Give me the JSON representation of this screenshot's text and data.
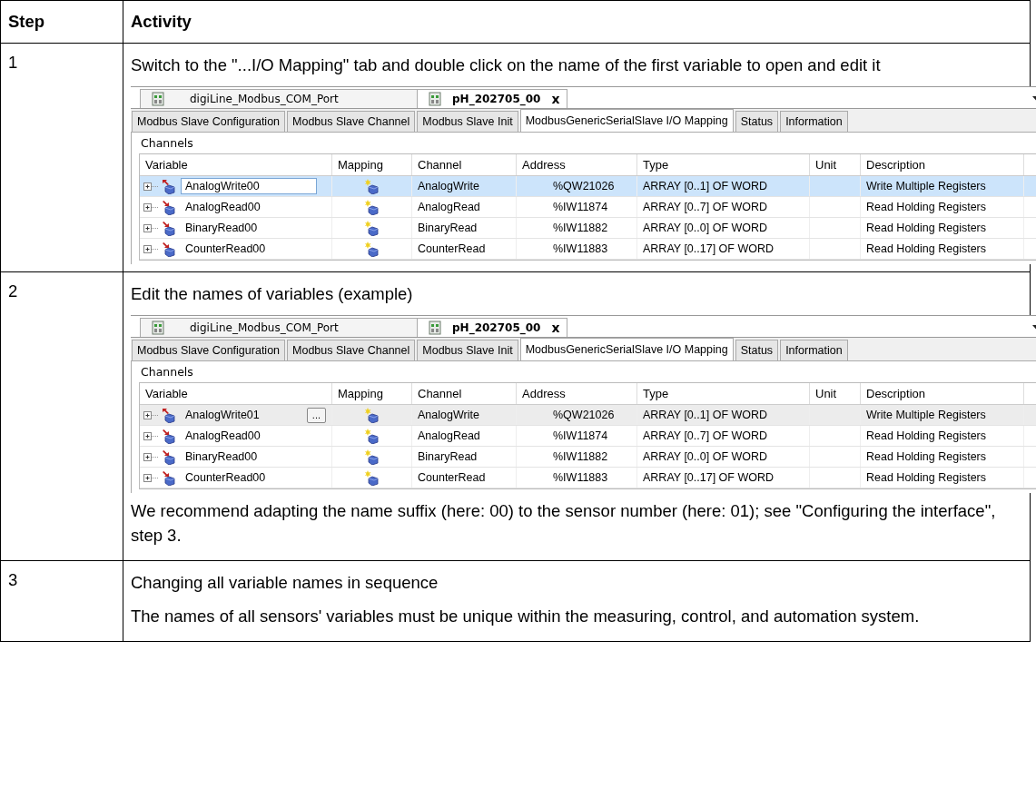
{
  "table": {
    "columns": [
      "Step",
      "Activity"
    ],
    "rows": [
      {
        "step": "1",
        "blocks": [
          {
            "kind": "text",
            "text": "Switch to the \"...I/O Mapping\" tab and double click on the name of the first variable to open and edit it"
          },
          {
            "kind": "screenshot",
            "screen": {
              "doc_tabs": [
                {
                  "label": "digiLine_Modbus_COM_Port",
                  "selected": false
                },
                {
                  "label": "pH_202705_00",
                  "selected": true,
                  "close": "x"
                }
              ],
              "view_tabs": [
                {
                  "label": "Modbus Slave Configuration",
                  "selected": false
                },
                {
                  "label": "Modbus Slave Channel",
                  "selected": false
                },
                {
                  "label": "Modbus Slave Init",
                  "selected": false
                },
                {
                  "label": "ModbusGenericSerialSlave I/O Mapping",
                  "selected": true
                },
                {
                  "label": "Status",
                  "selected": false
                },
                {
                  "label": "Information",
                  "selected": false
                }
              ],
              "group": "Channels",
              "columns": [
                "Variable",
                "Mapping",
                "Channel",
                "Address",
                "Type",
                "Unit",
                "Description"
              ],
              "rows": [
                {
                  "variable": "AnalogWrite00",
                  "channel": "AnalogWrite",
                  "address": "%QW21026",
                  "type": "ARRAY [0..1] OF WORD",
                  "description": "Write Multiple Registers",
                  "selected": true,
                  "editing": true,
                  "output": true
                },
                {
                  "variable": "AnalogRead00",
                  "channel": "AnalogRead",
                  "address": "%IW11874",
                  "type": "ARRAY [0..7] OF WORD",
                  "description": "Read Holding Registers",
                  "selected": false,
                  "editing": false,
                  "output": false
                },
                {
                  "variable": "BinaryRead00",
                  "channel": "BinaryRead",
                  "address": "%IW11882",
                  "type": "ARRAY [0..0] OF WORD",
                  "description": "Read Holding Registers",
                  "selected": false,
                  "editing": false,
                  "output": false
                },
                {
                  "variable": "CounterRead00",
                  "channel": "CounterRead",
                  "address": "%IW11883",
                  "type": "ARRAY [0..17] OF WORD",
                  "description": "Read Holding Registers",
                  "selected": false,
                  "editing": false,
                  "output": false
                }
              ]
            }
          }
        ]
      },
      {
        "step": "2",
        "blocks": [
          {
            "kind": "text",
            "text": "Edit the names of variables (example)"
          },
          {
            "kind": "screenshot",
            "screen": {
              "doc_tabs": [
                {
                  "label": "digiLine_Modbus_COM_Port",
                  "selected": false
                },
                {
                  "label": "pH_202705_00",
                  "selected": true,
                  "close": "x"
                }
              ],
              "view_tabs": [
                {
                  "label": "Modbus Slave Configuration",
                  "selected": false
                },
                {
                  "label": "Modbus Slave Channel",
                  "selected": false
                },
                {
                  "label": "Modbus Slave Init",
                  "selected": false
                },
                {
                  "label": "ModbusGenericSerialSlave I/O Mapping",
                  "selected": true
                },
                {
                  "label": "Status",
                  "selected": false
                },
                {
                  "label": "Information",
                  "selected": false
                }
              ],
              "group": "Channels",
              "columns": [
                "Variable",
                "Mapping",
                "Channel",
                "Address",
                "Type",
                "Unit",
                "Description"
              ],
              "rows": [
                {
                  "variable": "AnalogWrite01",
                  "edit_button": "...",
                  "channel": "AnalogWrite",
                  "address": "%QW21026",
                  "type": "ARRAY [0..1] OF WORD",
                  "description": "Write Multiple Registers",
                  "selected": false,
                  "editing": true,
                  "output": true
                },
                {
                  "variable": "AnalogRead00",
                  "channel": "AnalogRead",
                  "address": "%IW11874",
                  "type": "ARRAY [0..7] OF WORD",
                  "description": "Read Holding Registers",
                  "selected": false,
                  "editing": false,
                  "output": false
                },
                {
                  "variable": "BinaryRead00",
                  "channel": "BinaryRead",
                  "address": "%IW11882",
                  "type": "ARRAY [0..0] OF WORD",
                  "description": "Read Holding Registers",
                  "selected": false,
                  "editing": false,
                  "output": false
                },
                {
                  "variable": "CounterRead00",
                  "channel": "CounterRead",
                  "address": "%IW11883",
                  "type": "ARRAY [0..17] OF WORD",
                  "description": "Read Holding Registers",
                  "selected": false,
                  "editing": false,
                  "output": false
                }
              ]
            }
          },
          {
            "kind": "text",
            "text": "We recommend adapting the name suffix (here: 00) to the sensor number (here: 01); see \"Configuring the interface\", step 3."
          }
        ]
      },
      {
        "step": "3",
        "blocks": [
          {
            "kind": "text",
            "text": "Changing all variable names in sequence"
          },
          {
            "kind": "text",
            "text": "The names of all sensors' variables must be unique within the measuring, control, and automation system."
          }
        ]
      }
    ]
  }
}
